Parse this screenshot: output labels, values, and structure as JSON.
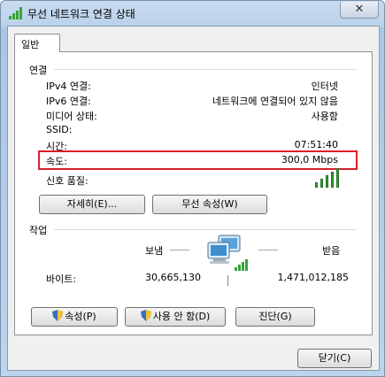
{
  "window": {
    "title": "무선 네트워크 연결 상태",
    "close_label": "✕"
  },
  "tab": {
    "label": "일반"
  },
  "connection": {
    "section_label": "연결",
    "rows": [
      {
        "label": "IPv4 연결:",
        "value": "인터넷"
      },
      {
        "label": "IPv6 연결:",
        "value": "네트워크에 연결되어 있지 않음"
      },
      {
        "label": "미디어 상태:",
        "value": "사용함"
      },
      {
        "label": "SSID:",
        "value": ""
      },
      {
        "label": "시간:",
        "value": "07:51:40"
      },
      {
        "label": "속도:",
        "value": "300,0 Mbps"
      }
    ],
    "signal_label": "신호 품질:",
    "signal_level": 5,
    "signal_max": 5,
    "details_button": "자세히(E)...",
    "wireless_props_button": "무선 속성(W)"
  },
  "activity": {
    "section_label": "작업",
    "sent_label": "보냄",
    "received_label": "받음",
    "bytes_label": "바이트:",
    "bytes_sent": "30,665,130",
    "bytes_received": "1,471,012,185"
  },
  "actions": {
    "properties_button": "속성(P)",
    "disable_button": "사용 안 함(D)",
    "diagnose_button": "진단(G)"
  },
  "footer": {
    "close_button": "닫기(C)"
  },
  "colors": {
    "highlight_border": "#d9202a",
    "signal_green": "#3aa23a"
  }
}
